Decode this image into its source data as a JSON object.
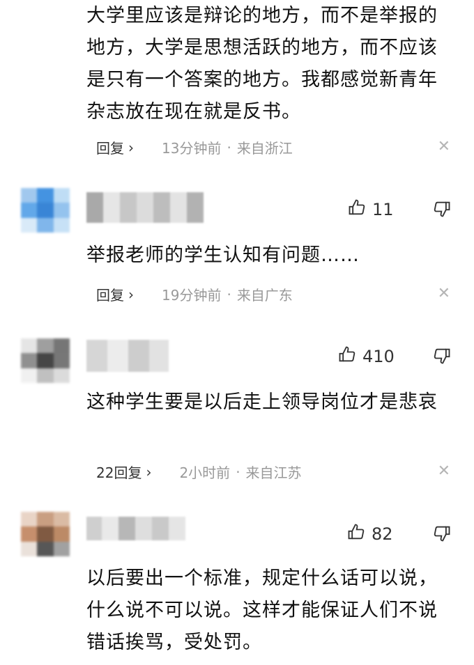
{
  "comments": [
    {
      "text": "大学里应该是辩论的地方，而不是举报的地方，大学是思想活跃的地方，而不应该是只有一个答案的地方。我都感觉新青年杂志放在现在就是反书。",
      "reply_label": "回复",
      "time": "13分钟前",
      "location": "来自浙江"
    },
    {
      "likes": "11",
      "text": "举报老师的学生认知有问题……",
      "reply_label": "回复",
      "time": "19分钟前",
      "location": "来自广东"
    },
    {
      "likes": "410",
      "text": "这种学生要是以后走上领导岗位才是悲哀",
      "reply_label": "22回复",
      "time": "2小时前",
      "location": "来自江苏"
    },
    {
      "likes": "82",
      "text": "以后要出一个标准，规定什么话可以说，什么说不可以说。这样才能保证人们不说错话挨骂，受处罚。"
    }
  ],
  "icons": {
    "like": "thumbs-up-icon",
    "dislike": "thumbs-down-icon",
    "close": "close-icon",
    "chevron": "chevron-right-icon"
  },
  "colors": {
    "text": "#111111",
    "meta": "#999999",
    "background": "#ffffff"
  }
}
